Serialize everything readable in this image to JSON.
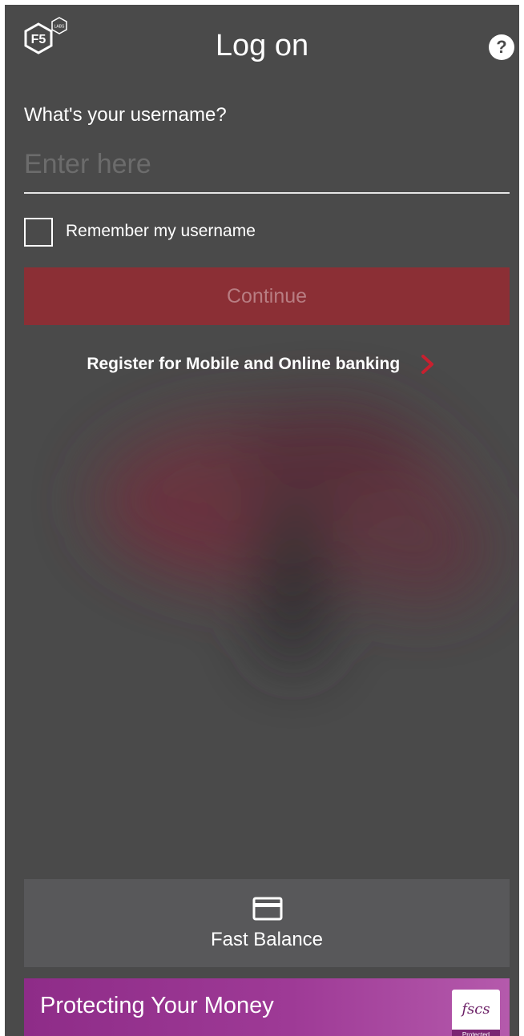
{
  "header": {
    "logo_text": "F5",
    "logo_badge": "LABS",
    "title": "Log on",
    "help_icon": "question-mark-icon",
    "help_glyph": "?"
  },
  "form": {
    "username_label": "What's your username?",
    "username_placeholder": "Enter here",
    "username_value": "",
    "remember_label": "Remember my username",
    "remember_checked": false,
    "continue_label": "Continue"
  },
  "register": {
    "label": "Register for Mobile and Online banking",
    "icon": "chevron-right-icon"
  },
  "fast_balance": {
    "icon": "card-icon",
    "label": "Fast Balance"
  },
  "banner": {
    "text": "Protecting Your Money",
    "badge_text": "fscs",
    "badge_subtext": "Protected"
  },
  "colors": {
    "background": "#4a4a4a",
    "continue_button": "#8b2f35",
    "chevron_accent": "#c8202f",
    "banner_purple": "#9e3a96",
    "fast_balance_bg": "#58585a"
  }
}
